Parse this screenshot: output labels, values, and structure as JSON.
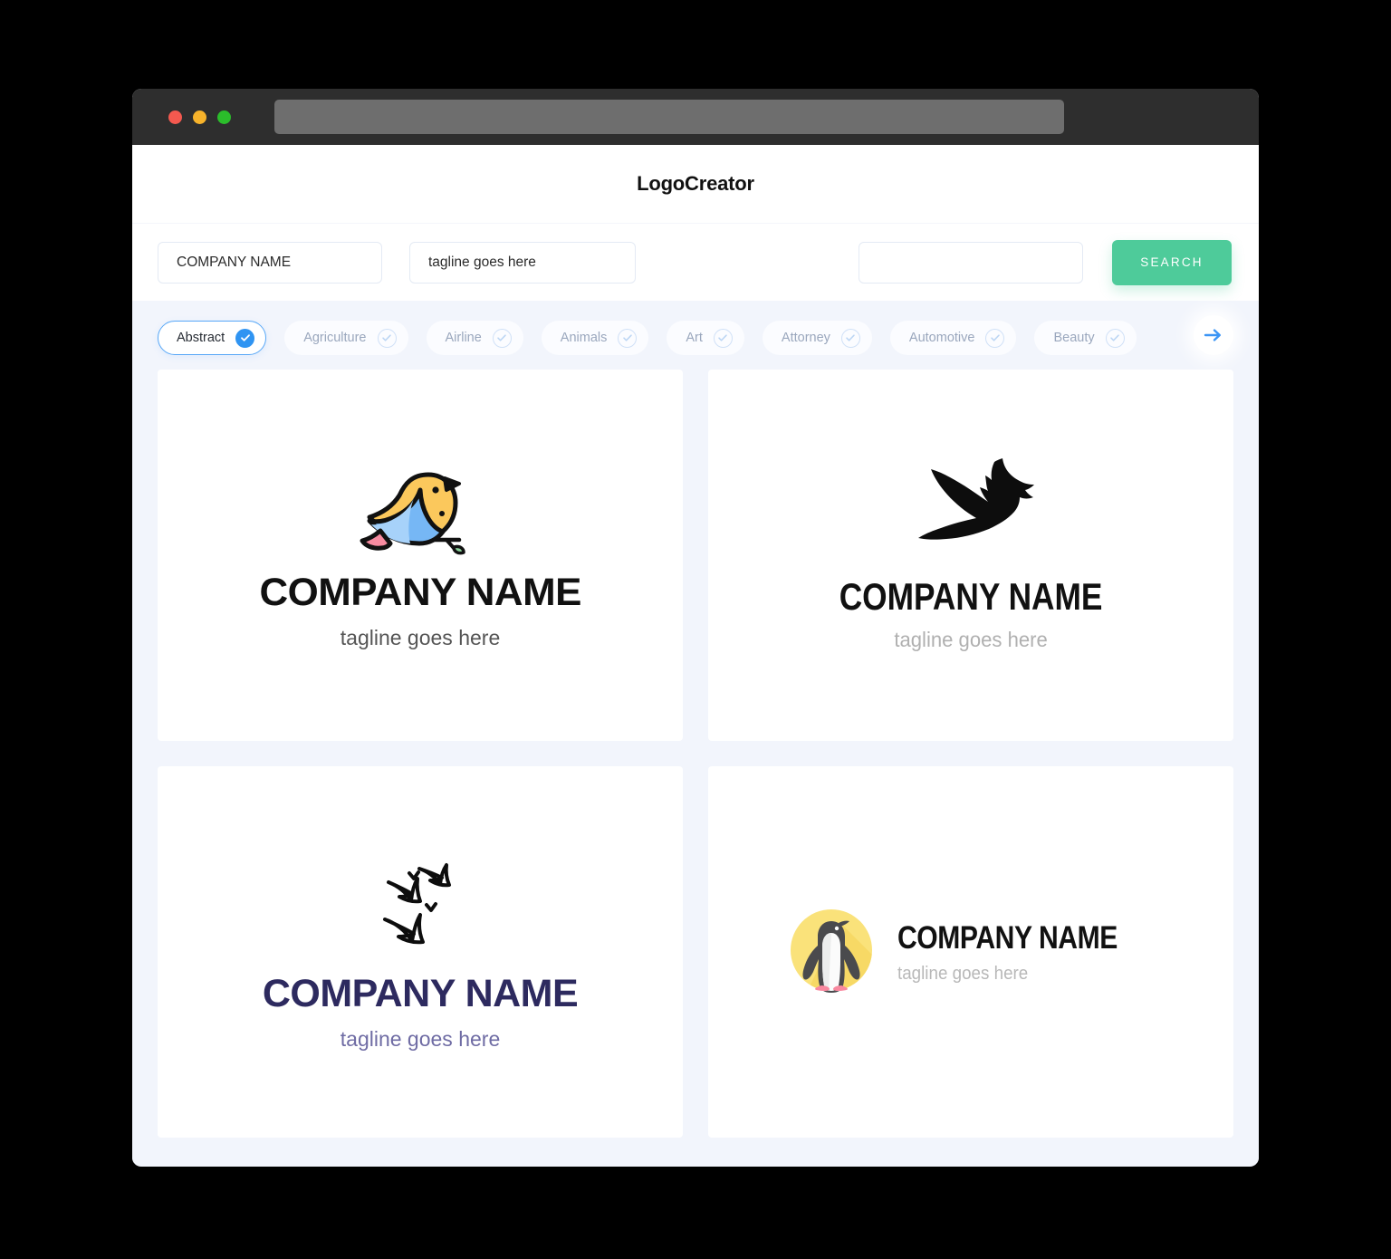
{
  "browser": {
    "traffic_lights": [
      "close",
      "minimize",
      "maximize"
    ],
    "address_bar_value": ""
  },
  "header": {
    "brand": "LogoCreator"
  },
  "search": {
    "company_value": "COMPANY NAME",
    "company_placeholder": "COMPANY NAME",
    "tagline_value": "tagline goes here",
    "tagline_placeholder": "tagline goes here",
    "third_value": "",
    "third_placeholder": "",
    "button_label": "SEARCH",
    "button_color": "#4ecb9a"
  },
  "filters": {
    "selected": "Abstract",
    "accent_color": "#2f94f2",
    "chips": [
      {
        "label": "Abstract",
        "selected": true
      },
      {
        "label": "Agriculture",
        "selected": false
      },
      {
        "label": "Airline",
        "selected": false
      },
      {
        "label": "Animals",
        "selected": false
      },
      {
        "label": "Art",
        "selected": false
      },
      {
        "label": "Attorney",
        "selected": false
      },
      {
        "label": "Automotive",
        "selected": false
      },
      {
        "label": "Beauty",
        "selected": false
      }
    ],
    "next_icon": "arrow-right-icon"
  },
  "results": [
    {
      "icon": "songbird-on-branch-icon",
      "name": "COMPANY NAME",
      "tagline": "tagline goes here",
      "name_color": "#111111",
      "tagline_color": "#555555",
      "layout": "stacked"
    },
    {
      "icon": "dove-silhouette-icon",
      "name": "COMPANY NAME",
      "tagline": "tagline goes here",
      "name_color": "#111111",
      "tagline_color": "#b0b0b0",
      "layout": "stacked"
    },
    {
      "icon": "flying-birds-flock-icon",
      "name": "COMPANY NAME",
      "tagline": "tagline goes here",
      "name_color": "#2d2a5f",
      "tagline_color": "#6f6ca4",
      "layout": "stacked"
    },
    {
      "icon": "penguin-badge-icon",
      "name": "COMPANY NAME",
      "tagline": "tagline goes here",
      "name_color": "#111111",
      "tagline_color": "#b8b8b8",
      "layout": "horizontal"
    }
  ]
}
